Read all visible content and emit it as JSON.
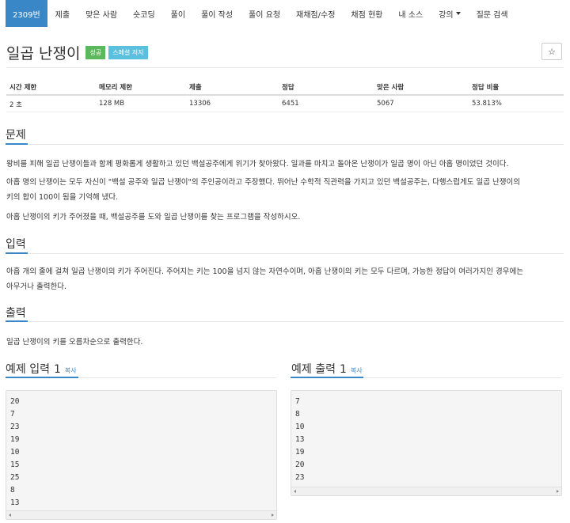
{
  "nav": {
    "items": [
      {
        "label": "2309번"
      },
      {
        "label": "제출"
      },
      {
        "label": "맞은 사람"
      },
      {
        "label": "숏코딩"
      },
      {
        "label": "풀이"
      },
      {
        "label": "풀이 작성"
      },
      {
        "label": "풀이 요청"
      },
      {
        "label": "재채점/수정"
      },
      {
        "label": "채점 현황"
      },
      {
        "label": "내 소스"
      },
      {
        "label": "강의"
      },
      {
        "label": "질문 검색"
      }
    ]
  },
  "problem": {
    "title": "일곱 난쟁이",
    "badge_success": "성공",
    "badge_special": "스페셜 저지",
    "star_glyph": "☆"
  },
  "info": {
    "headers": [
      "시간 제한",
      "메모리 제한",
      "제출",
      "정답",
      "맞은 사람",
      "정답 비율"
    ],
    "values": [
      "2 초",
      "128 MB",
      "13306",
      "6451",
      "5067",
      "53.813%"
    ]
  },
  "sections": {
    "problem_heading": "문제",
    "problem_p1": "왕비를 피해 일곱 난쟁이들과 함께 평화롭게 생활하고 있던 백설공주에게 위기가 찾아왔다. 일과를 마치고 돌아온 난쟁이가 일곱 명이 아닌 아홉 명이었던 것이다.",
    "problem_p2a": "아홉 명의 난쟁이는 모두 자신이 \"백설 공주와 일곱 난쟁이\"의 주인공이라고 주장했다. 뛰어난 수학적 직관력을 가지고 있던 백설공주는, 다행스럽게도 일곱 난쟁이의",
    "problem_p2b": "키의 합이 100이 됨을 기억해 냈다.",
    "problem_p3": "아홉 난쟁이의 키가 주어졌을 때, 백설공주를 도와 일곱 난쟁이를 찾는 프로그램을 작성하시오.",
    "input_heading": "입력",
    "input_p1a": "아홉 개의 줄에 걸쳐 일곱 난쟁이의 키가 주어진다. 주어지는 키는 100을 넘지 않는 자연수이며, 아홉 난쟁이의 키는 모두 다르며, 가능한 정답이 여러가지인 경우에는",
    "input_p1b": "아무거나 출력한다.",
    "output_heading": "출력",
    "output_p1": "일곱 난쟁이의 키를 오름차순으로 출력한다."
  },
  "samples": {
    "input_title": "예제 입력",
    "input_num": "1",
    "output_title": "예제 출력",
    "output_num": "1",
    "copy_label": "복사",
    "input_lines": [
      "20",
      "7",
      "23",
      "19",
      "10",
      "15",
      "25",
      "8",
      "13"
    ],
    "output_lines": [
      "7",
      "8",
      "10",
      "13",
      "19",
      "20",
      "23"
    ]
  },
  "colors": {
    "accent": "#3a87c8",
    "success": "#5cb85c",
    "info": "#5bc0de"
  }
}
